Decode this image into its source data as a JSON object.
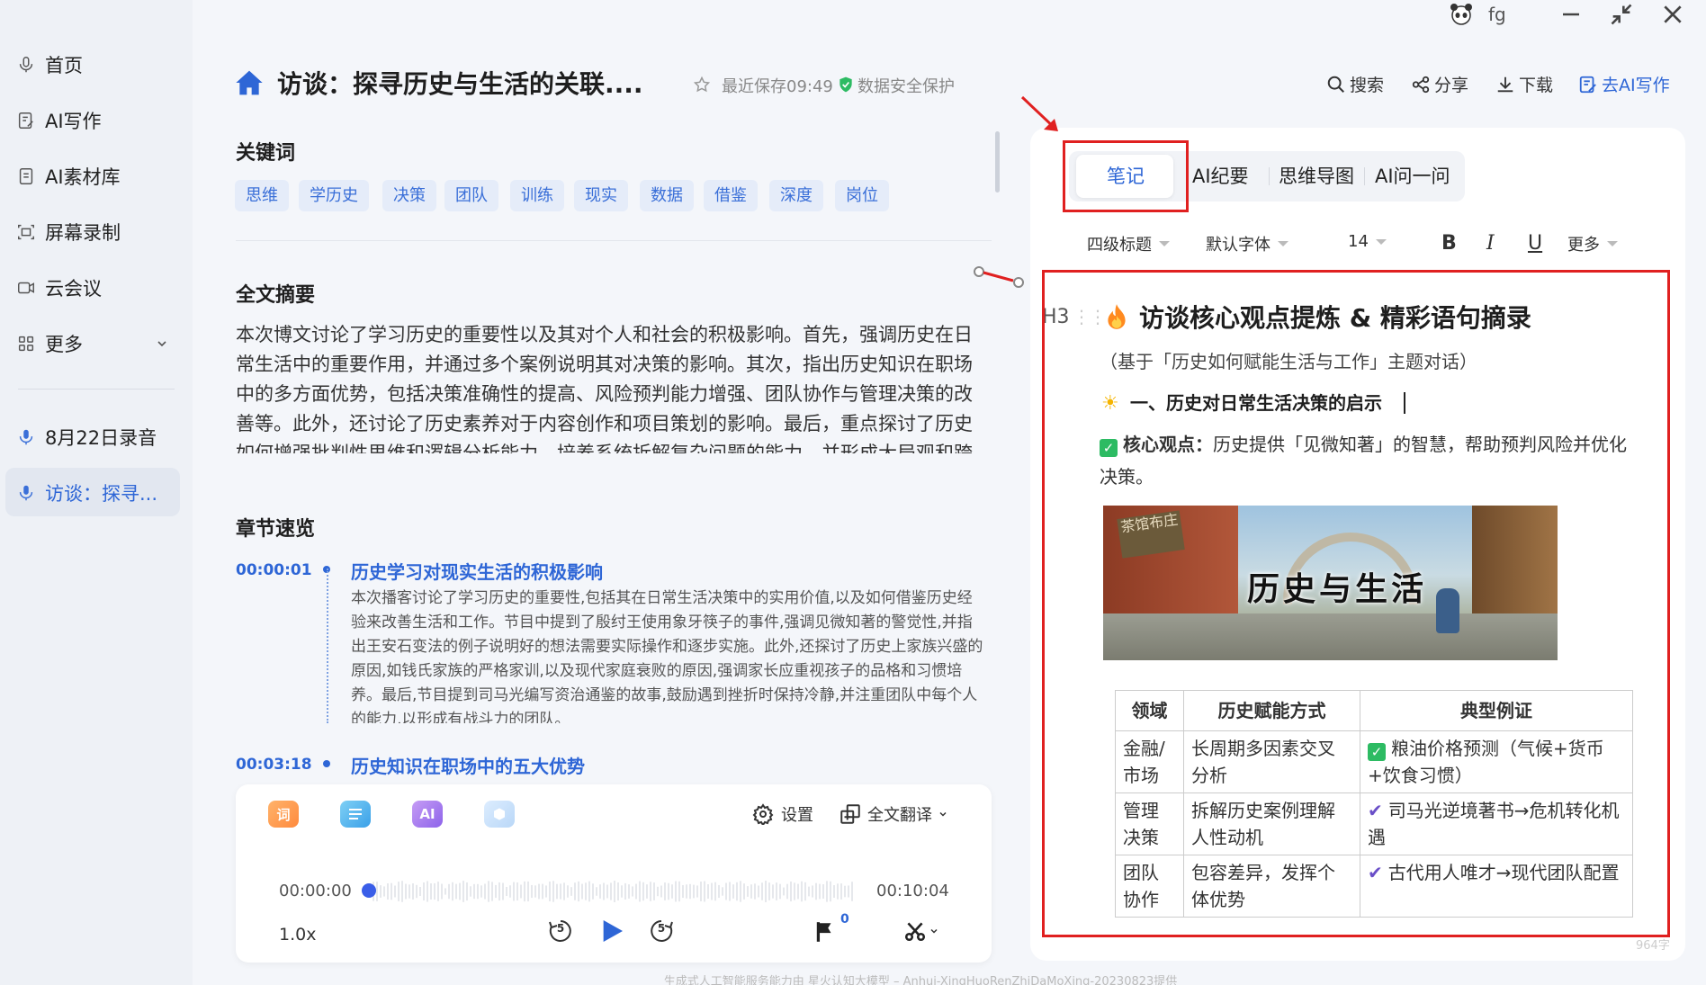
{
  "titlebar": {
    "username": "fg"
  },
  "sidebar": {
    "items": [
      {
        "label": "首页"
      },
      {
        "label": "AI写作"
      },
      {
        "label": "AI素材库"
      },
      {
        "label": "屏幕录制"
      },
      {
        "label": "云会议"
      },
      {
        "label": "更多"
      }
    ],
    "recordings": [
      {
        "label": "8月22日录音"
      },
      {
        "label": "访谈：探寻..."
      }
    ]
  },
  "header": {
    "title": "访谈：探寻历史与生活的关联....",
    "save_status": "最近保存09:49",
    "security": "数据安全保护",
    "actions": {
      "search": "搜索",
      "share": "分享",
      "download": "下载",
      "ai_write": "去AI写作"
    }
  },
  "keywords": {
    "heading": "关键词",
    "tags": [
      "思维",
      "学历史",
      "决策",
      "团队",
      "训练",
      "现实",
      "数据",
      "借鉴",
      "深度",
      "岗位"
    ]
  },
  "summary": {
    "heading": "全文摘要",
    "text": "本次博文讨论了学习历史的重要性以及其对个人和社会的积极影响。首先，强调历史在日常生活中的重要作用，并通过多个案例说明其对决策的影响。其次，指出历史知识在职场中的多方面优势，包括决策准确性的提高、风险预判能力增强、团队协作与管理决策的改善等。此外，还讨论了历史素养对于内容创作和项目策划的影响。最后，重点探讨了历史如何增强批判性思维和逻辑分析能力，培养系统拆解复杂问题的能力，并形成大局观和跨"
  },
  "chapters": {
    "heading": "章节速览",
    "items": [
      {
        "time": "00:00:01",
        "title": "历史学习对现实生活的积极影响",
        "body": "本次播客讨论了学习历史的重要性,包括其在日常生活决策中的实用价值,以及如何借鉴历史经验来改善生活和工作。节目中提到了殷纣王使用象牙筷子的事件,强调见微知著的警觉性,并指出王安石变法的例子说明好的想法需要实际操作和逐步实施。此外,还探讨了历史上家族兴盛的原因,如钱氏家族的严格家训,以及现代家庭衰败的原因,强调家长应重视孩子的品格和习惯培养。最后,节目提到司马光编写资治通鉴的故事,鼓励遇到挫折时保持冷静,并注重团队中每个人的能力,以形成有战斗力的团队。"
      },
      {
        "time": "00:03:18",
        "title": "历史知识在职场中的五大优势"
      }
    ]
  },
  "player": {
    "tool_word": "词",
    "tool_ai": "AI",
    "settings": "设置",
    "translate": "全文翻译",
    "current_time": "00:00:00",
    "total_time": "00:10:04",
    "progress": 0,
    "speed": "1.0x",
    "skip_back": "5",
    "skip_fwd": "5",
    "flag_count": "0"
  },
  "notes": {
    "tabs": [
      "笔记",
      "AI纪要",
      "思维导图",
      "AI问一问"
    ],
    "active_tab": "笔记",
    "format": {
      "heading": "四级标题",
      "font": "默认字体",
      "size": "14",
      "bold": "B",
      "italic": "I",
      "underline": "U",
      "more": "更多"
    },
    "heading_marker": "H3",
    "doc": {
      "title": "访谈核心观点提炼 & 精彩语句摘录",
      "subtitle": "（基于「历史如何赋能生活与工作」主题对话）",
      "section1": "一、历史对日常生活决策的启示",
      "core_label": "核心观点：",
      "core_text": "历史提供「见微知著」的智慧，帮助预判风险并优化决策。",
      "image_caption": "历史与生活",
      "image_sign": "茶馆布庄",
      "table": {
        "headers": [
          "领域",
          "历史赋能方式",
          "典型例证"
        ],
        "rows": [
          [
            "金融/市场",
            "长周期多因素交叉分析",
            "粮油价格预测（气候+货币+饮食习惯）"
          ],
          [
            "管理决策",
            "拆解历史案例理解人性动机",
            "司马光逆境著书→危机转化机遇"
          ],
          [
            "团队协作",
            "包容差异，发挥个体优势",
            "古代用人唯才→现代团队配置"
          ]
        ]
      }
    },
    "word_count": "964字"
  },
  "footer": {
    "text": "生成式人工智能服务能力由 星火认知大模型 – Anhui-XingHuoRenZhiDaMoXing-20230823提供"
  },
  "colors": {
    "accent": "#2e66d6",
    "annotation": "#e02020",
    "tag_bg": "#e5ecf9"
  }
}
